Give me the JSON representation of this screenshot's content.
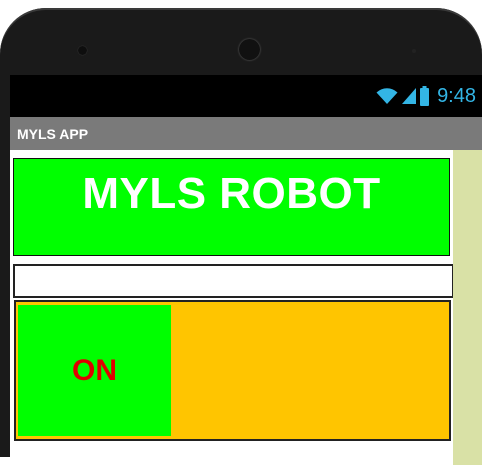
{
  "status_bar": {
    "time": "9:48",
    "icons": [
      "wifi-icon",
      "signal-icon",
      "battery-icon"
    ],
    "clock_color": "#33b5e5"
  },
  "app": {
    "title": "MYLS APP"
  },
  "main": {
    "header_text": "MYLS ROBOT",
    "input_value": "",
    "on_button_label": "ON"
  },
  "colors": {
    "header_bg": "#00ff00",
    "panel_bg": "#ffc500",
    "button_bg": "#00ff00",
    "button_text": "#e00000",
    "titlebar_bg": "#7a7a7a",
    "scrollbar_bg": "#d9e1a6"
  }
}
